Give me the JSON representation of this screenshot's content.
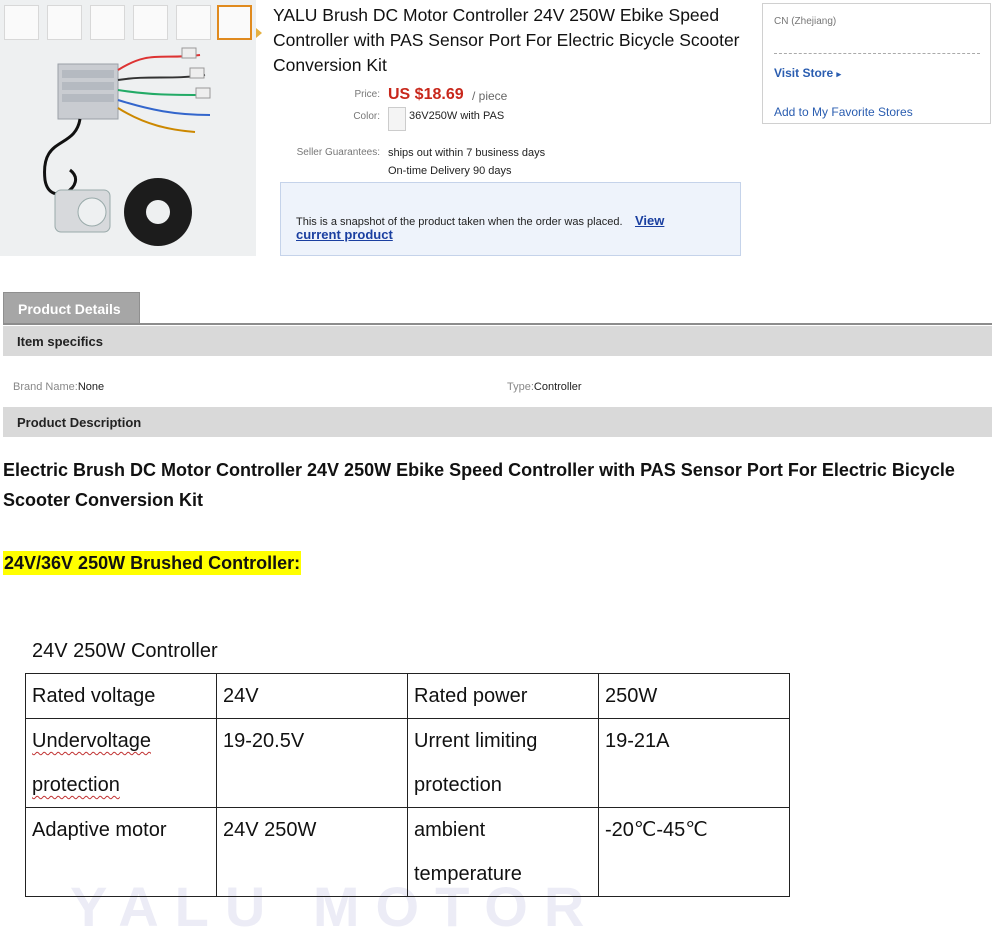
{
  "product": {
    "title": "YALU Brush DC Motor Controller 24V 250W Ebike Speed Controller with PAS Sensor Port For Electric Bicycle Scooter Conversion Kit",
    "price_label": "Price:",
    "price": "US $18.69",
    "price_unit": "/ piece",
    "color_label": "Color:",
    "color_value": "36V250W with PAS",
    "guarantee_label": "Seller Guarantees:",
    "guarantee_1": "ships out within 7 business days",
    "guarantee_2": "On-time Delivery 90 days"
  },
  "snapshot": {
    "text": "This is a snapshot of the product taken when the order was placed.",
    "link_line1": "View",
    "link_line2": "current product"
  },
  "store": {
    "location": "CN (Zhejiang)",
    "visit": "Visit Store",
    "favorite": "Add to My Favorite Stores"
  },
  "tabs": {
    "details": "Product Details"
  },
  "specs": {
    "header": "Item specifics",
    "brand_key": "Brand Name:",
    "brand_val": "None",
    "type_key": "Type:",
    "type_val": "Controller"
  },
  "description": {
    "header": "Product Description",
    "title": "Electric Brush DC Motor Controller 24V 250W Ebike Speed Controller with PAS Sensor Port For Electric Bicycle Scooter Conversion Kit",
    "subtitle": "24V/36V 250W Brushed Controller:"
  },
  "spec_image": {
    "caption": "24V 250W Controller",
    "rows": [
      [
        "Rated voltage",
        "24V",
        "Rated power",
        "250W"
      ],
      [
        "Undervoltage protection",
        "19-20.5V",
        "Urrent limiting protection",
        "19-21A"
      ],
      [
        "Adaptive motor",
        "24V 250W",
        "ambient temperature",
        "-20℃-45℃"
      ]
    ],
    "watermark": "YALU MOTOR"
  },
  "colors": {
    "price": "#c8271b",
    "link": "#1a3fa0",
    "tab": "#a6a6a6",
    "section_bar": "#d9d9d9",
    "highlight": "#ffff00"
  }
}
